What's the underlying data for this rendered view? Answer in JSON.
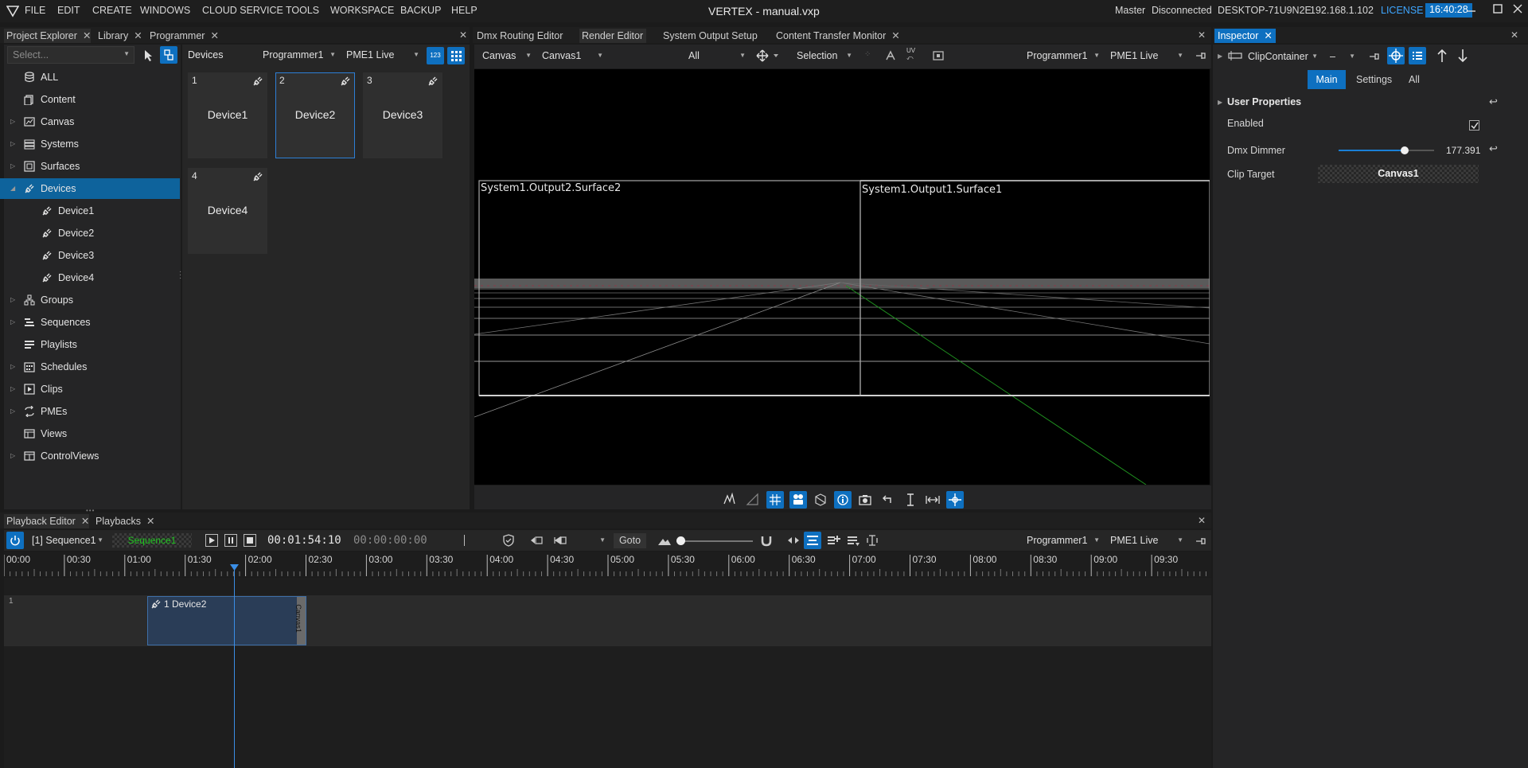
{
  "app": {
    "title": "VERTEX - manual.vxp",
    "menu": [
      "FILE",
      "EDIT",
      "CREATE",
      "WINDOWS",
      "CLOUD SERVICE",
      "TOOLS",
      "WORKSPACE",
      "BACKUP",
      "HELP"
    ],
    "status": {
      "role": "Master",
      "connection": "Disconnected",
      "host": "DESKTOP-71U9N2E",
      "ip": "192.168.1.102",
      "license": "LICENSE",
      "clock": "16:40:28"
    }
  },
  "left_panel": {
    "tabs": [
      "Project Explorer",
      "Library",
      "Programmer"
    ],
    "search_placeholder": "Select...",
    "tree": [
      {
        "label": "ALL",
        "icon": "database-icon",
        "expandable": false
      },
      {
        "label": "Content",
        "icon": "content-icon",
        "expandable": false
      },
      {
        "label": "Canvas",
        "icon": "canvas-icon",
        "expandable": true
      },
      {
        "label": "Systems",
        "icon": "systems-icon",
        "expandable": true
      },
      {
        "label": "Surfaces",
        "icon": "surfaces-icon",
        "expandable": true
      },
      {
        "label": "Devices",
        "icon": "plug-icon",
        "expandable": true,
        "expanded": true,
        "selected": true
      },
      {
        "label": "Device1",
        "icon": "plug-icon",
        "child": true
      },
      {
        "label": "Device2",
        "icon": "plug-icon",
        "child": true
      },
      {
        "label": "Device3",
        "icon": "plug-icon",
        "child": true
      },
      {
        "label": "Device4",
        "icon": "plug-icon",
        "child": true
      },
      {
        "label": "Groups",
        "icon": "groups-icon",
        "expandable": true
      },
      {
        "label": "Sequences",
        "icon": "sequences-icon",
        "expandable": true
      },
      {
        "label": "Playlists",
        "icon": "playlists-icon",
        "expandable": false
      },
      {
        "label": "Schedules",
        "icon": "calendar-icon",
        "expandable": true
      },
      {
        "label": "Clips",
        "icon": "clips-icon",
        "expandable": true
      },
      {
        "label": "PMEs",
        "icon": "pme-icon",
        "expandable": true
      },
      {
        "label": "Views",
        "icon": "views-icon",
        "expandable": false
      },
      {
        "label": "ControlViews",
        "icon": "controlviews-icon",
        "expandable": true
      }
    ]
  },
  "devices_panel": {
    "title": "Devices",
    "programmer": "Programmer1",
    "pme": "PME1 Live",
    "numbered_toggle": "123",
    "tiles": [
      {
        "num": "1",
        "name": "Device1"
      },
      {
        "num": "2",
        "name": "Device2",
        "selected": true
      },
      {
        "num": "3",
        "name": "Device3"
      },
      {
        "num": "4",
        "name": "Device4"
      }
    ]
  },
  "render_panel": {
    "tabs": [
      "Dmx Routing Editor",
      "Render Editor",
      "System Output Setup",
      "Content Transfer Monitor"
    ],
    "active_tab": "Render Editor",
    "view_select": "Canvas",
    "canvas_select": "Canvas1",
    "filter_select": "All",
    "tool_select": "Selection",
    "programmer": "Programmer1",
    "pme": "PME1 Live",
    "surfaces": [
      "System1.Output2.Surface2",
      "System1.Output1.Surface1"
    ],
    "bottom_tools": [
      "waveform-icon",
      "ruler-icon",
      "grid-icon",
      "camera-group-icon",
      "cube-icon",
      "info-icon",
      "snapshot-icon",
      "undo-icon",
      "text-cursor-icon",
      "fit-width-icon",
      "move-icon"
    ],
    "bottom_tools_active": [
      "grid-icon",
      "camera-group-icon",
      "info-icon",
      "move-icon"
    ],
    "uv_label": "UV"
  },
  "inspector": {
    "tab": "Inspector",
    "object": "ClipContainer",
    "dash_select": "–",
    "subtabs": [
      "Main",
      "Settings",
      "All"
    ],
    "active_subtab": "Main",
    "section": "User Properties",
    "enabled_label": "Enabled",
    "enabled": true,
    "dimmer_label": "Dmx Dimmer",
    "dimmer_value": "177.391",
    "dimmer_level": 0.6957,
    "clip_target_label": "Clip Target",
    "clip_target_value": "Canvas1"
  },
  "playback": {
    "tabs": [
      "Playback Editor",
      "Playbacks"
    ],
    "sequence_select": "[1] Sequence1",
    "sequence_name": "Sequence1",
    "timecode": "00:01:54:10",
    "timecode_total": "00:00:00:00",
    "goto_label": "Goto",
    "programmer": "Programmer1",
    "pme": "PME1 Live",
    "ruler": [
      "00:00",
      "00:30",
      "01:00",
      "01:30",
      "02:00",
      "02:30",
      "03:00",
      "03:30",
      "04:00",
      "04:30",
      "05:00",
      "05:30",
      "06:00",
      "06:30",
      "07:00",
      "07:30",
      "08:00",
      "08:30",
      "09:00",
      "09:30"
    ],
    "track_number": "1",
    "clip_label": "1 Device2",
    "clip_side_label": "Canvas1",
    "zoom_level": 0.0
  },
  "colors": {
    "accent": "#0e70c0",
    "selected_tree": "#0e639c",
    "clip_fill": "#2a3d57",
    "playhead": "#3a8ee6",
    "green_line": "#1f8f1f"
  }
}
